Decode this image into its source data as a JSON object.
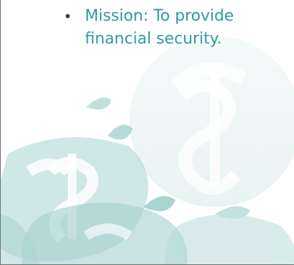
{
  "slide": {
    "bullet_char": "•",
    "line1": "Mission: To provide",
    "line2": "financial security."
  },
  "theme": {
    "text_color": "#2e9c9c",
    "watermark_color": "#a8d4d2"
  },
  "watermark": {
    "icon": "apple-dollar-icon"
  }
}
